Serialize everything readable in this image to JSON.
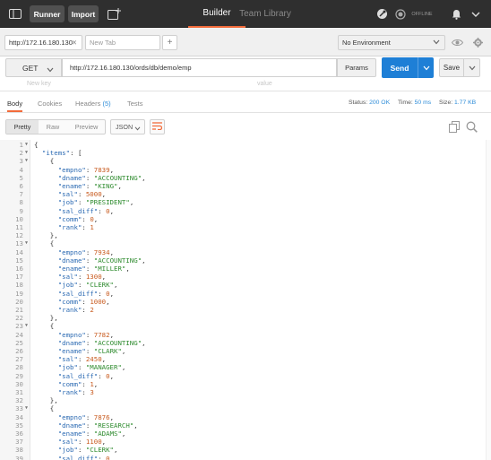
{
  "header": {
    "runner_label": "Runner",
    "import_label": "Import",
    "builder_tab": "Builder",
    "library_tab": "Team Library",
    "offline_label": "OFFLINE",
    "accent": "#f26b3a"
  },
  "tabs": {
    "active_tab": "http://172.16.180.130",
    "new_tab": "New Tab",
    "environment": "No Environment"
  },
  "request": {
    "method": "GET",
    "url": "http://172.16.180.130/ords/db/demo/emp",
    "params_label": "Params",
    "send_label": "Send",
    "save_label": "Save",
    "key_placeholder": "New key",
    "value_placeholder": "value"
  },
  "response": {
    "tabs": [
      "Body",
      "Cookies",
      "Headers",
      "(5)",
      "Tests"
    ],
    "status_label": "Status:",
    "status_value": "200 OK",
    "time_label": "Time:",
    "time_value": "50 ms",
    "size_label": "Size:",
    "size_value": "1.77 KB"
  },
  "viewer": {
    "pretty": "Pretty",
    "raw": "Raw",
    "preview": "Preview",
    "format": "JSON"
  },
  "code_lines": [
    "{",
    "  \"items\": [",
    "    {",
    "      \"empno\": 7839,",
    "      \"dname\": \"ACCOUNTING\",",
    "      \"ename\": \"KING\",",
    "      \"sal\": 5000,",
    "      \"job\": \"PRESIDENT\",",
    "      \"sal_diff\": 0,",
    "      \"comm\": 0,",
    "      \"rank\": 1",
    "    },",
    "    {",
    "      \"empno\": 7934,",
    "      \"dname\": \"ACCOUNTING\",",
    "      \"ename\": \"MILLER\",",
    "      \"sal\": 1300,",
    "      \"job\": \"CLERK\",",
    "      \"sal_diff\": 0,",
    "      \"comm\": 1000,",
    "      \"rank\": 2",
    "    },",
    "    {",
    "      \"empno\": 7782,",
    "      \"dname\": \"ACCOUNTING\",",
    "      \"ename\": \"CLARK\",",
    "      \"sal\": 2450,",
    "      \"job\": \"MANAGER\",",
    "      \"sal_diff\": 0,",
    "      \"comm\": 1,",
    "      \"rank\": 3",
    "    },",
    "    {",
    "      \"empno\": 7876,",
    "      \"dname\": \"RESEARCH\",",
    "      \"ename\": \"ADAMS\",",
    "      \"sal\": 1100,",
    "      \"job\": \"CLERK\",",
    "      \"sal_diff\": 0,"
  ],
  "fold_lines": [
    1,
    2,
    3,
    13,
    23,
    33
  ]
}
